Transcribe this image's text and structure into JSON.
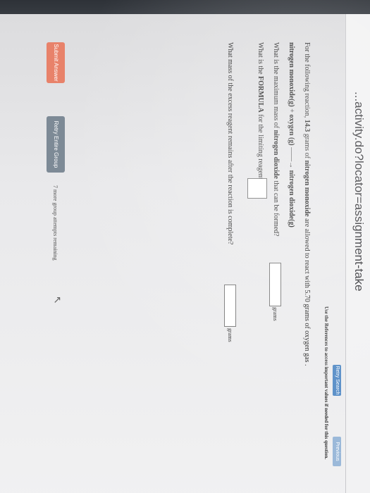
{
  "browser": {
    "url": "...activity.do?locator=assignment-take"
  },
  "toolbar": {
    "tab1": "Retry Search",
    "tab2": "Previous"
  },
  "references_note": "Use the References to access important values if needed for this question.",
  "question": {
    "intro_pre": "For the following reaction, ",
    "intro_mass1": "14.3",
    "intro_mid1": " grams of ",
    "intro_reactant1": "nitrogen monoxide",
    "intro_mid2": " are allowed to react with 5.70 grams of oxygen gas .",
    "equation_r1": "nitrogen monoxide(g)",
    "equation_plus": " + ",
    "equation_r2": "oxygen (g)",
    "equation_arrow": " ——→ ",
    "equation_p": "nitrogen dioxide(g)",
    "q1_pre": "What is the maximum mass of ",
    "q1_bold": "nitrogen dioxide",
    "q1_post": " that can be formed?",
    "q1_unit": "grams",
    "q2_pre": "What is the ",
    "q2_bold": "FORMULA",
    "q2_post": " for the limiting reagent?",
    "q3_text": "What mass of the excess reagent remains after the reaction is complete?",
    "q3_unit": "grams"
  },
  "buttons": {
    "submit": "Submit Answer",
    "retry": "Retry Entire Group",
    "attempts": "7 more group attempts remaining"
  }
}
